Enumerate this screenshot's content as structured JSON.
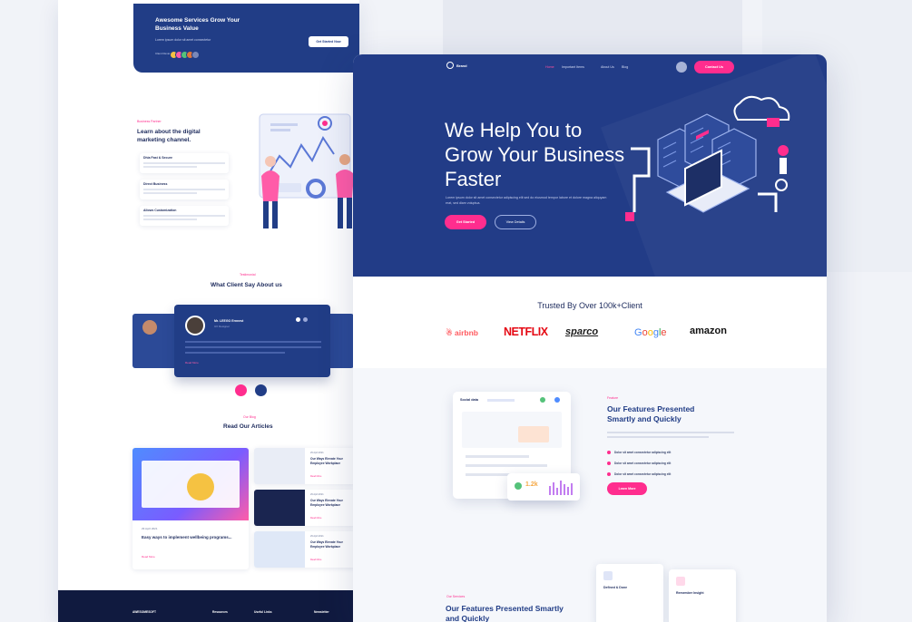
{
  "left_page": {
    "hero": {
      "title": "Awesome Services Grow Your Business Value",
      "subtitle": "Lorem ipsum dolor sit amet consectetur",
      "button": "Get Started Now",
      "rating_label": "Client Reviews"
    },
    "digital": {
      "tag": "Business Partner",
      "title": "Learn about the digital marketing channel.",
      "cards": [
        "Dhia Fast & Secure",
        "Direct Business",
        "Allows Customization"
      ]
    },
    "testimonials": {
      "tag": "Testimonial",
      "title": "What Client Say About us",
      "person_name": "Mr. LEEGO Ernnest",
      "person_role": "UX Designer",
      "read_more": "Read More"
    },
    "articles": {
      "tag": "Our Blog",
      "title": "Read Our Articles",
      "big": {
        "date": "29 April 2021",
        "title": "Easy ways to implement wellbeing programs...",
        "read": "Read More"
      },
      "small": [
        {
          "date": "29 April 2021",
          "title": "Our Ways Elevate Your Employee Workplace",
          "read": "Read More"
        },
        {
          "date": "29 April 2021",
          "title": "Our Ways Elevate Your Employee Workplace",
          "read": "Read More"
        },
        {
          "date": "29 April 2021",
          "title": "Our Ways Elevate Your Employee Workplace",
          "read": "Read More"
        }
      ]
    },
    "footer": [
      "AWESOMESOFT",
      "Resources",
      "Useful Links",
      "Newsletter"
    ]
  },
  "right_page": {
    "logo": "Brand",
    "nav": [
      "Home",
      "Important Items",
      "About Us",
      "Blog"
    ],
    "contact_button": "Contact Us",
    "headline": "We Help You to Grow Your Business Faster",
    "subtext": "Lorem ipsum dolor sit amet consectetur adipiscing elit sed do eiusmod tempor labore et dolore magna aliquyam erat, sed diam voluptua.",
    "btn_start": "Get Started",
    "btn_details": "View Details",
    "trusted": "Trusted By Over 100k+Client",
    "brands": {
      "airbnb": "airbnb",
      "netflix": "NETFLIX",
      "sparco": "sparco",
      "google": "Google",
      "amazon": "amazon"
    },
    "features": {
      "mock_title": "Social data",
      "tag": "Feature",
      "title": "Our Features Presented Smartly and Quickly",
      "bullets": [
        "Dolor sit amet consectetur adipiscing elit",
        "Dolor sit amet consectetur adipiscing elit",
        "Dolor sit amet consectetur adipiscing elit"
      ],
      "button": "Learn More",
      "popup_value": "1.2k"
    },
    "features2": {
      "tag": "Our Services",
      "title": "Our Features Presented Smartly and Quickly",
      "cards": [
        "Defined & Done",
        "Remember Insight"
      ]
    }
  },
  "colors": {
    "navy": "#223c87",
    "pink": "#ff2d8e",
    "dark_text": "#1c2a5c",
    "background": "#f1f3f8"
  }
}
